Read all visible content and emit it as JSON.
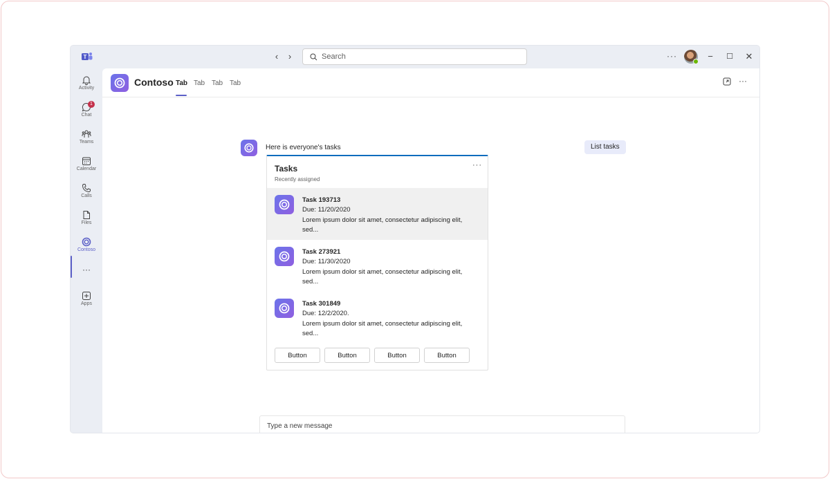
{
  "search": {
    "placeholder": "Search"
  },
  "titlebar": {
    "more": "···",
    "minimize": "−",
    "maximize": "☐",
    "close": "✕",
    "back": "‹",
    "forward": "›"
  },
  "rail": {
    "items": [
      {
        "label": "Activity",
        "icon": "bell-icon"
      },
      {
        "label": "Chat",
        "icon": "chat-icon",
        "badge": "1"
      },
      {
        "label": "Teams",
        "icon": "teams-icon"
      },
      {
        "label": "Calendar",
        "icon": "calendar-icon"
      },
      {
        "label": "Calls",
        "icon": "phone-icon"
      },
      {
        "label": "Files",
        "icon": "file-icon"
      },
      {
        "label": "Contoso",
        "icon": "contoso-icon",
        "active": true
      },
      {
        "label": "",
        "icon": "more-icon"
      },
      {
        "label": "Apps",
        "icon": "apps-icon"
      }
    ],
    "more": "···"
  },
  "header": {
    "app_title": "Contoso",
    "tabs": [
      "Tab",
      "Tab",
      "Tab",
      "Tab"
    ],
    "more": "···"
  },
  "chat": {
    "user_message": "List tasks",
    "bot_message": "Here is everyone's tasks"
  },
  "card": {
    "title": "Tasks",
    "subtitle": "Recently assigned",
    "more": "···",
    "tasks": [
      {
        "name": "Task 193713",
        "due": "Due: 11/20/2020",
        "desc": "Lorem ipsum dolor sit amet, consectetur adipiscing elit, sed..."
      },
      {
        "name": "Task 273921",
        "due": "Due: 11/30/2020",
        "desc": "Lorem ipsum dolor sit amet, consectetur adipiscing elit, sed..."
      },
      {
        "name": "Task 301849",
        "due": "Due: 12/2/2020.",
        "desc": "Lorem ipsum dolor sit amet, consectetur adipiscing elit, sed..."
      }
    ],
    "buttons": [
      "Button",
      "Button",
      "Button",
      "Button"
    ]
  },
  "composer": {
    "placeholder": "Type a new message"
  },
  "colors": {
    "accent": "#5b5fc7",
    "card_border": "#0f6cbd",
    "badge": "#c4314b",
    "presence": "#6bb700"
  }
}
